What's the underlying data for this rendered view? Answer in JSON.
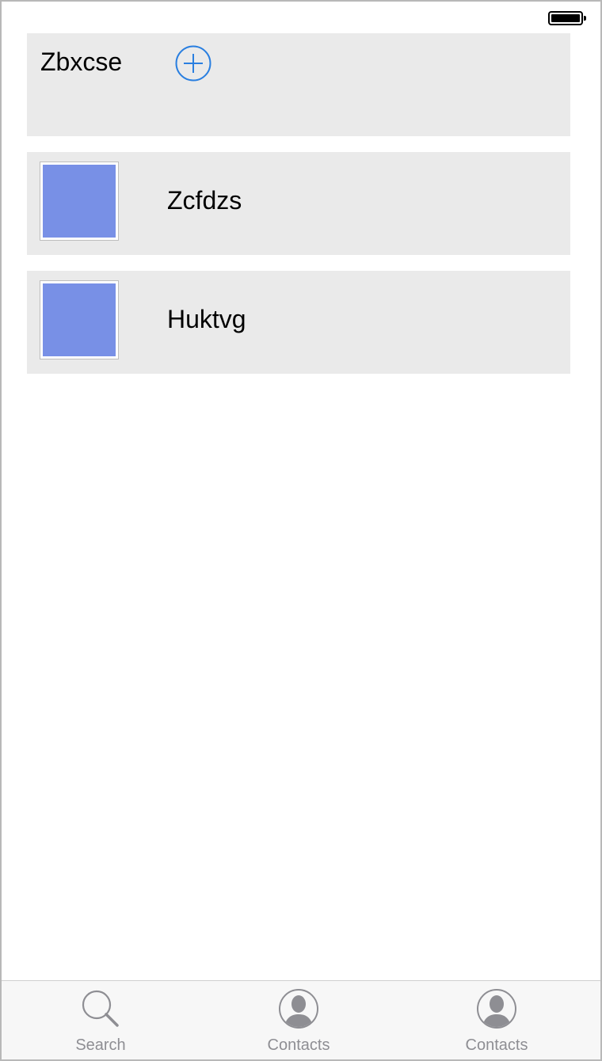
{
  "header": {
    "title": "Zbxcse",
    "add_icon": "plus-circle-icon",
    "accent_color": "#2a7fe0"
  },
  "list": {
    "thumb_color": "#7890e6",
    "items": [
      {
        "label": "Zcfdzs",
        "icon": "image-thumbnail"
      },
      {
        "label": "Huktvg",
        "icon": "image-thumbnail"
      }
    ]
  },
  "tabbar": {
    "tabs": [
      {
        "label": "Search",
        "icon": "search-icon"
      },
      {
        "label": "Contacts",
        "icon": "contact-icon"
      },
      {
        "label": "Contacts",
        "icon": "contact-icon"
      }
    ],
    "label_color": "#8e8e93"
  }
}
